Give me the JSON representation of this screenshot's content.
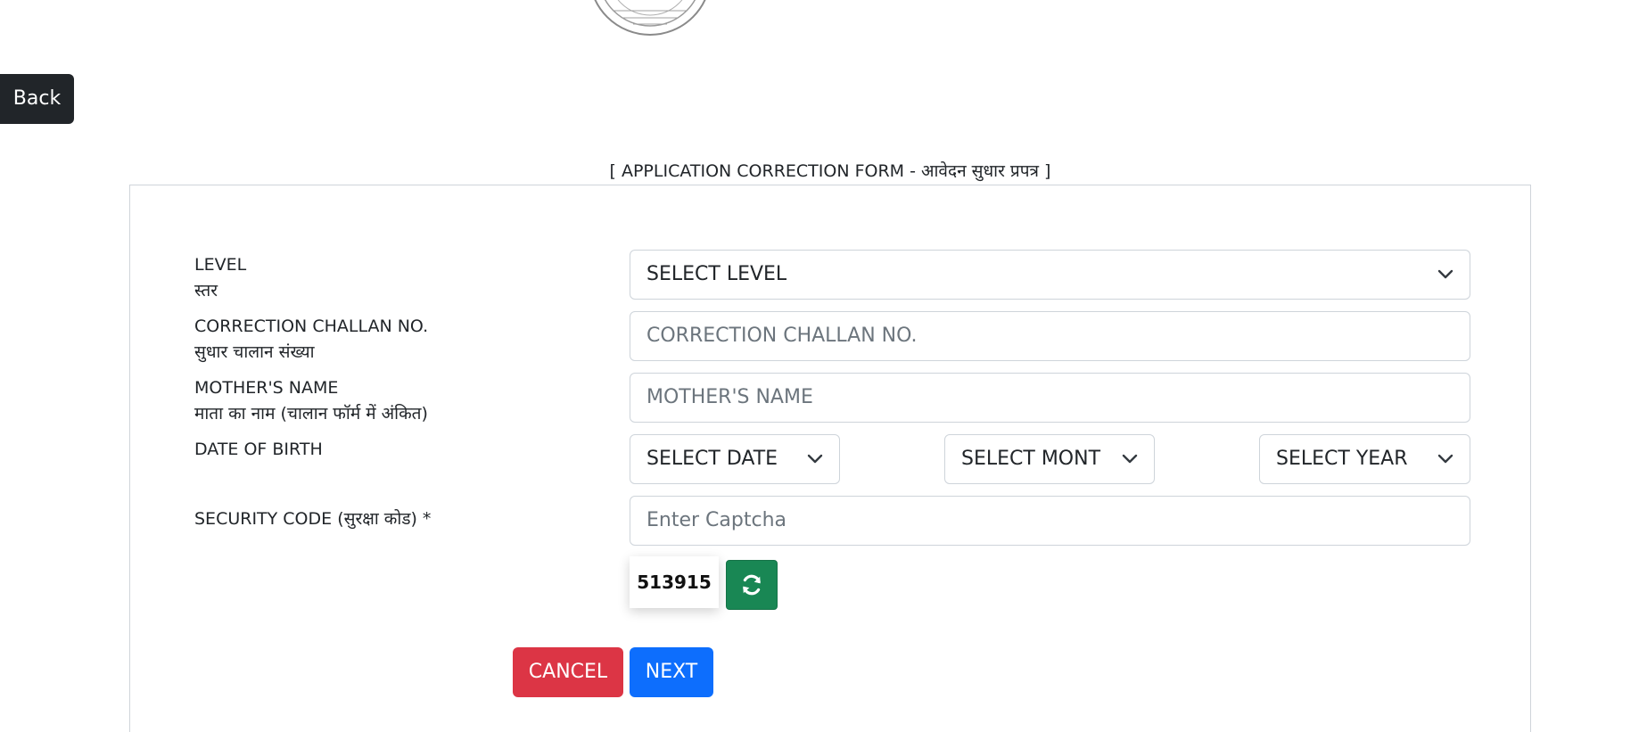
{
  "back_button": {
    "label": "Back"
  },
  "form_title": "[ APPLICATION CORRECTION FORM - आवेदन सुधार प्रपत्र ]",
  "fields": {
    "level": {
      "label_en": "LEVEL",
      "label_hi": "स्तर",
      "selected": "SELECT LEVEL"
    },
    "challan": {
      "label_en": "CORRECTION CHALLAN NO.",
      "label_hi": "सुधार चालान संख्या",
      "placeholder": "CORRECTION CHALLAN NO.",
      "value": ""
    },
    "mother": {
      "label_en": "MOTHER'S NAME",
      "label_hi": "माता का नाम (चालान फॉर्म में अंकित)",
      "placeholder": "MOTHER'S NAME",
      "value": ""
    },
    "dob": {
      "label_en": "DATE OF BIRTH",
      "date_selected": "SELECT DATE",
      "month_selected": "SELECT MONTH",
      "year_selected": "SELECT YEAR"
    },
    "security": {
      "label": "SECURITY CODE (सुरक्षा कोड) *",
      "placeholder": "Enter Captcha",
      "value": ""
    }
  },
  "captcha": {
    "code": "513915",
    "refresh_icon": "refresh-icon"
  },
  "actions": {
    "cancel_label": "CANCEL",
    "next_label": "NEXT"
  },
  "colors": {
    "back": "#212529",
    "cancel": "#dc3545",
    "next": "#0d6efd",
    "refresh": "#198754"
  }
}
